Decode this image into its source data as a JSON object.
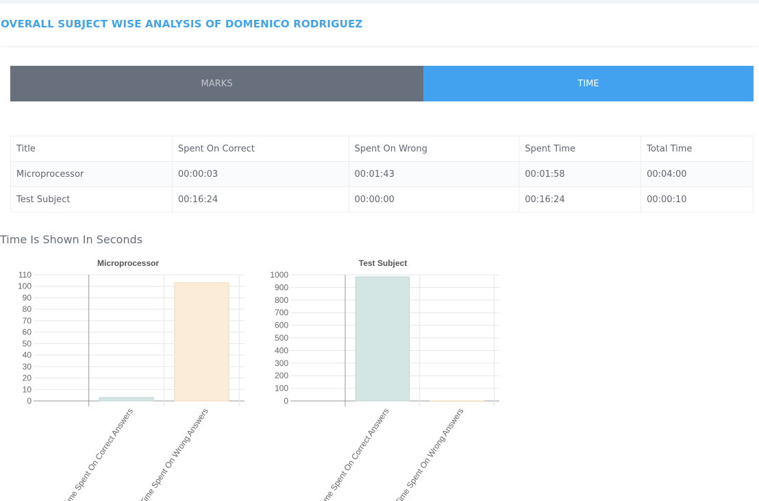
{
  "header": {
    "title": "OVERALL SUBJECT WISE ANALYSIS OF DOMENICO RODRIGUEZ"
  },
  "tabs": [
    {
      "label": "MARKS",
      "active": false
    },
    {
      "label": "TIME",
      "active": true
    }
  ],
  "table": {
    "columns": [
      "Title",
      "Spent On Correct",
      "Spent On Wrong",
      "Spent Time",
      "Total Time"
    ],
    "rows": [
      [
        "Microprocessor",
        "00:00:03",
        "00:01:43",
        "00:01:58",
        "00:04:00"
      ],
      [
        "Test Subject",
        "00:16:24",
        "00:00:00",
        "00:16:24",
        "00:00:10"
      ]
    ]
  },
  "note": "Time Is Shown In Seconds",
  "colors": {
    "accent": "#42a2ef",
    "tab_inactive": "#686f7d",
    "bar_correct": "#d3e6e3",
    "bar_wrong": "#faecd8"
  },
  "chart_data": [
    {
      "type": "bar",
      "title": "Microprocessor",
      "categories": [
        "Time Spent On Correct Answers",
        "Time Spent On Wrong Answers"
      ],
      "values": [
        3,
        103
      ],
      "ylim": [
        0,
        110
      ],
      "yticks": [
        0,
        10,
        20,
        30,
        40,
        50,
        60,
        70,
        80,
        90,
        100,
        110
      ],
      "grid": true
    },
    {
      "type": "bar",
      "title": "Test Subject",
      "categories": [
        "Time Spent On Correct Answers",
        "Time Spent On Wrong Answers"
      ],
      "values": [
        984,
        0
      ],
      "ylim": [
        0,
        1000
      ],
      "yticks": [
        0,
        100,
        200,
        300,
        400,
        500,
        600,
        700,
        800,
        900,
        1000
      ],
      "grid": true
    }
  ]
}
